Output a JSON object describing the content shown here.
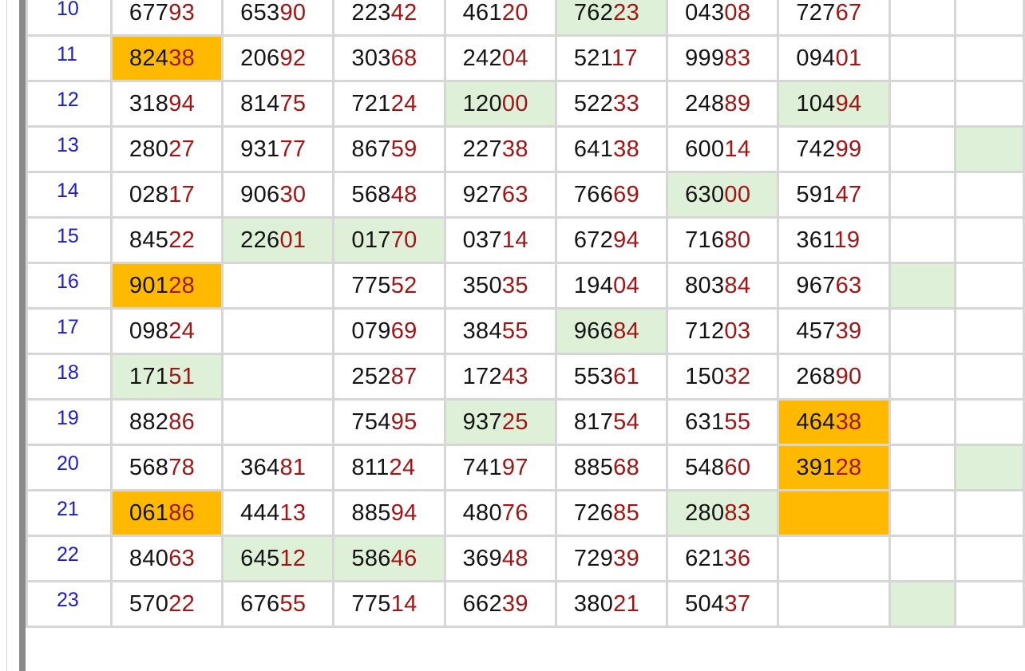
{
  "colors": {
    "index_text": "#1a1adb",
    "head_digits": "#141414",
    "tail_digits": "#a31515",
    "highlight_green": "#dff0d8",
    "highlight_orange": "#ffba00",
    "grid_border": "#d6d6d6"
  },
  "rows": [
    {
      "index": "10",
      "cells": [
        {
          "head": "677",
          "tail": "93",
          "hl": ""
        },
        {
          "head": "653",
          "tail": "90",
          "hl": ""
        },
        {
          "head": "223",
          "tail": "42",
          "hl": ""
        },
        {
          "head": "461",
          "tail": "20",
          "hl": ""
        },
        {
          "head": "762",
          "tail": "23",
          "hl": "green"
        },
        {
          "head": "043",
          "tail": "08",
          "hl": ""
        },
        {
          "head": "727",
          "tail": "67",
          "hl": ""
        }
      ],
      "extra": [
        "",
        ""
      ]
    },
    {
      "index": "11",
      "cells": [
        {
          "head": "824",
          "tail": "38",
          "hl": "orange"
        },
        {
          "head": "206",
          "tail": "92",
          "hl": ""
        },
        {
          "head": "303",
          "tail": "68",
          "hl": ""
        },
        {
          "head": "242",
          "tail": "04",
          "hl": ""
        },
        {
          "head": "521",
          "tail": "17",
          "hl": ""
        },
        {
          "head": "999",
          "tail": "83",
          "hl": ""
        },
        {
          "head": "094",
          "tail": "01",
          "hl": ""
        }
      ],
      "extra": [
        "",
        ""
      ]
    },
    {
      "index": "12",
      "cells": [
        {
          "head": "318",
          "tail": "94",
          "hl": ""
        },
        {
          "head": "814",
          "tail": "75",
          "hl": ""
        },
        {
          "head": "721",
          "tail": "24",
          "hl": ""
        },
        {
          "head": "120",
          "tail": "00",
          "hl": "green"
        },
        {
          "head": "522",
          "tail": "33",
          "hl": ""
        },
        {
          "head": "248",
          "tail": "89",
          "hl": ""
        },
        {
          "head": "104",
          "tail": "94",
          "hl": "green"
        }
      ],
      "extra": [
        "",
        ""
      ]
    },
    {
      "index": "13",
      "cells": [
        {
          "head": "280",
          "tail": "27",
          "hl": ""
        },
        {
          "head": "931",
          "tail": "77",
          "hl": ""
        },
        {
          "head": "867",
          "tail": "59",
          "hl": ""
        },
        {
          "head": "227",
          "tail": "38",
          "hl": ""
        },
        {
          "head": "641",
          "tail": "38",
          "hl": ""
        },
        {
          "head": "600",
          "tail": "14",
          "hl": ""
        },
        {
          "head": "742",
          "tail": "99",
          "hl": ""
        }
      ],
      "extra": [
        "",
        "green"
      ]
    },
    {
      "index": "14",
      "cells": [
        {
          "head": "028",
          "tail": "17",
          "hl": ""
        },
        {
          "head": "906",
          "tail": "30",
          "hl": ""
        },
        {
          "head": "568",
          "tail": "48",
          "hl": ""
        },
        {
          "head": "927",
          "tail": "63",
          "hl": ""
        },
        {
          "head": "766",
          "tail": "69",
          "hl": ""
        },
        {
          "head": "630",
          "tail": "00",
          "hl": "green"
        },
        {
          "head": "591",
          "tail": "47",
          "hl": ""
        }
      ],
      "extra": [
        "",
        ""
      ]
    },
    {
      "index": "15",
      "cells": [
        {
          "head": "845",
          "tail": "22",
          "hl": ""
        },
        {
          "head": "226",
          "tail": "01",
          "hl": "green"
        },
        {
          "head": "017",
          "tail": "70",
          "hl": "green"
        },
        {
          "head": "037",
          "tail": "14",
          "hl": ""
        },
        {
          "head": "672",
          "tail": "94",
          "hl": ""
        },
        {
          "head": "716",
          "tail": "80",
          "hl": ""
        },
        {
          "head": "361",
          "tail": "19",
          "hl": ""
        }
      ],
      "extra": [
        "",
        ""
      ]
    },
    {
      "index": "16",
      "cells": [
        {
          "head": "901",
          "tail": "28",
          "hl": "orange"
        },
        {
          "head": "",
          "tail": "",
          "hl": ""
        },
        {
          "head": "775",
          "tail": "52",
          "hl": ""
        },
        {
          "head": "350",
          "tail": "35",
          "hl": ""
        },
        {
          "head": "194",
          "tail": "04",
          "hl": ""
        },
        {
          "head": "803",
          "tail": "84",
          "hl": ""
        },
        {
          "head": "967",
          "tail": "63",
          "hl": ""
        }
      ],
      "extra": [
        "green",
        ""
      ]
    },
    {
      "index": "17",
      "cells": [
        {
          "head": "098",
          "tail": "24",
          "hl": ""
        },
        {
          "head": "",
          "tail": "",
          "hl": ""
        },
        {
          "head": "079",
          "tail": "69",
          "hl": ""
        },
        {
          "head": "384",
          "tail": "55",
          "hl": ""
        },
        {
          "head": "966",
          "tail": "84",
          "hl": "green"
        },
        {
          "head": "712",
          "tail": "03",
          "hl": ""
        },
        {
          "head": "457",
          "tail": "39",
          "hl": ""
        }
      ],
      "extra": [
        "",
        ""
      ]
    },
    {
      "index": "18",
      "cells": [
        {
          "head": "171",
          "tail": "51",
          "hl": "green"
        },
        {
          "head": "",
          "tail": "",
          "hl": ""
        },
        {
          "head": "252",
          "tail": "87",
          "hl": ""
        },
        {
          "head": "172",
          "tail": "43",
          "hl": ""
        },
        {
          "head": "553",
          "tail": "61",
          "hl": ""
        },
        {
          "head": "150",
          "tail": "32",
          "hl": ""
        },
        {
          "head": "268",
          "tail": "90",
          "hl": ""
        }
      ],
      "extra": [
        "",
        ""
      ]
    },
    {
      "index": "19",
      "cells": [
        {
          "head": "882",
          "tail": "86",
          "hl": ""
        },
        {
          "head": "",
          "tail": "",
          "hl": ""
        },
        {
          "head": "754",
          "tail": "95",
          "hl": ""
        },
        {
          "head": "937",
          "tail": "25",
          "hl": "green"
        },
        {
          "head": "817",
          "tail": "54",
          "hl": ""
        },
        {
          "head": "631",
          "tail": "55",
          "hl": ""
        },
        {
          "head": "464",
          "tail": "38",
          "hl": "orange"
        }
      ],
      "extra": [
        "",
        ""
      ]
    },
    {
      "index": "20",
      "cells": [
        {
          "head": "568",
          "tail": "78",
          "hl": ""
        },
        {
          "head": "364",
          "tail": "81",
          "hl": ""
        },
        {
          "head": "811",
          "tail": "24",
          "hl": ""
        },
        {
          "head": "741",
          "tail": "97",
          "hl": ""
        },
        {
          "head": "885",
          "tail": "68",
          "hl": ""
        },
        {
          "head": "548",
          "tail": "60",
          "hl": ""
        },
        {
          "head": "391",
          "tail": "28",
          "hl": "orange"
        }
      ],
      "extra": [
        "",
        "green"
      ]
    },
    {
      "index": "21",
      "cells": [
        {
          "head": "061",
          "tail": "86",
          "hl": "orange"
        },
        {
          "head": "444",
          "tail": "13",
          "hl": ""
        },
        {
          "head": "885",
          "tail": "94",
          "hl": ""
        },
        {
          "head": "480",
          "tail": "76",
          "hl": ""
        },
        {
          "head": "726",
          "tail": "85",
          "hl": ""
        },
        {
          "head": "280",
          "tail": "83",
          "hl": "green"
        },
        {
          "head": "",
          "tail": "",
          "hl": "orange"
        }
      ],
      "extra": [
        "",
        ""
      ]
    },
    {
      "index": "22",
      "cells": [
        {
          "head": "840",
          "tail": "63",
          "hl": ""
        },
        {
          "head": "645",
          "tail": "12",
          "hl": "green"
        },
        {
          "head": "586",
          "tail": "46",
          "hl": "green"
        },
        {
          "head": "369",
          "tail": "48",
          "hl": ""
        },
        {
          "head": "729",
          "tail": "39",
          "hl": ""
        },
        {
          "head": "621",
          "tail": "36",
          "hl": ""
        },
        {
          "head": "",
          "tail": "",
          "hl": ""
        }
      ],
      "extra": [
        "",
        ""
      ]
    },
    {
      "index": "23",
      "cells": [
        {
          "head": "570",
          "tail": "22",
          "hl": ""
        },
        {
          "head": "676",
          "tail": "55",
          "hl": ""
        },
        {
          "head": "775",
          "tail": "14",
          "hl": ""
        },
        {
          "head": "662",
          "tail": "39",
          "hl": ""
        },
        {
          "head": "380",
          "tail": "21",
          "hl": ""
        },
        {
          "head": "504",
          "tail": "37",
          "hl": ""
        },
        {
          "head": "",
          "tail": "",
          "hl": ""
        }
      ],
      "extra": [
        "green",
        ""
      ]
    }
  ]
}
